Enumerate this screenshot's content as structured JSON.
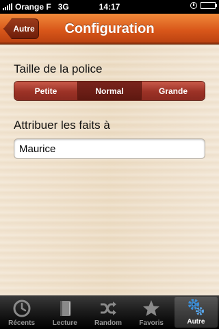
{
  "status_bar": {
    "carrier": "Orange F",
    "network": "3G",
    "time": "14:17"
  },
  "nav": {
    "back_label": "Autre",
    "title": "Configuration"
  },
  "font_size": {
    "label": "Taille de la police",
    "options": [
      "Petite",
      "Normal",
      "Grande"
    ],
    "selected": "Normal"
  },
  "attribution": {
    "label": "Attribuer les faits à",
    "value": "Maurice"
  },
  "tabs": [
    {
      "label": "Récents",
      "icon": "clock-icon",
      "active": false
    },
    {
      "label": "Lecture",
      "icon": "book-icon",
      "active": false
    },
    {
      "label": "Random",
      "icon": "shuffle-icon",
      "active": false
    },
    {
      "label": "Favoris",
      "icon": "star-icon",
      "active": false
    },
    {
      "label": "Autre",
      "icon": "gears-icon",
      "active": true
    }
  ],
  "colors": {
    "navbar": "#d9571a",
    "segment": "#9c3226",
    "segment_selected": "#5e1810",
    "tab_active_icon": "#3b8fd9"
  }
}
